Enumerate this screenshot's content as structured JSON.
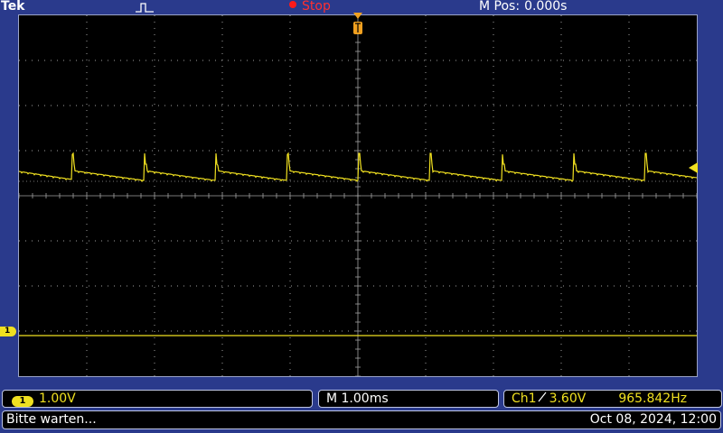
{
  "header": {
    "brand": "Tek",
    "acquisition_icon": "single-pulse-icon",
    "run_status": "Stop",
    "main_position_label": "M Pos:",
    "main_position_value": "0.000s"
  },
  "channel1": {
    "number": "1",
    "scale": "1.00V",
    "color": "#f0e020"
  },
  "horizontal": {
    "scale": "M 1.00ms"
  },
  "trigger": {
    "source": "Ch1",
    "slope_icon": "rising-edge-icon",
    "level": "3.60V",
    "frequency": "965.842Hz"
  },
  "message_bar": {
    "message": "Bitte warten...",
    "datetime": "Oct 08, 2024, 12:00"
  },
  "colors": {
    "background": "#2a3a8c",
    "screen": "#000000",
    "trace": "#f0e020",
    "graticule": "#a0a0a0",
    "status_stop": "#ff3030",
    "trigger_marker": "#f0a020"
  }
}
